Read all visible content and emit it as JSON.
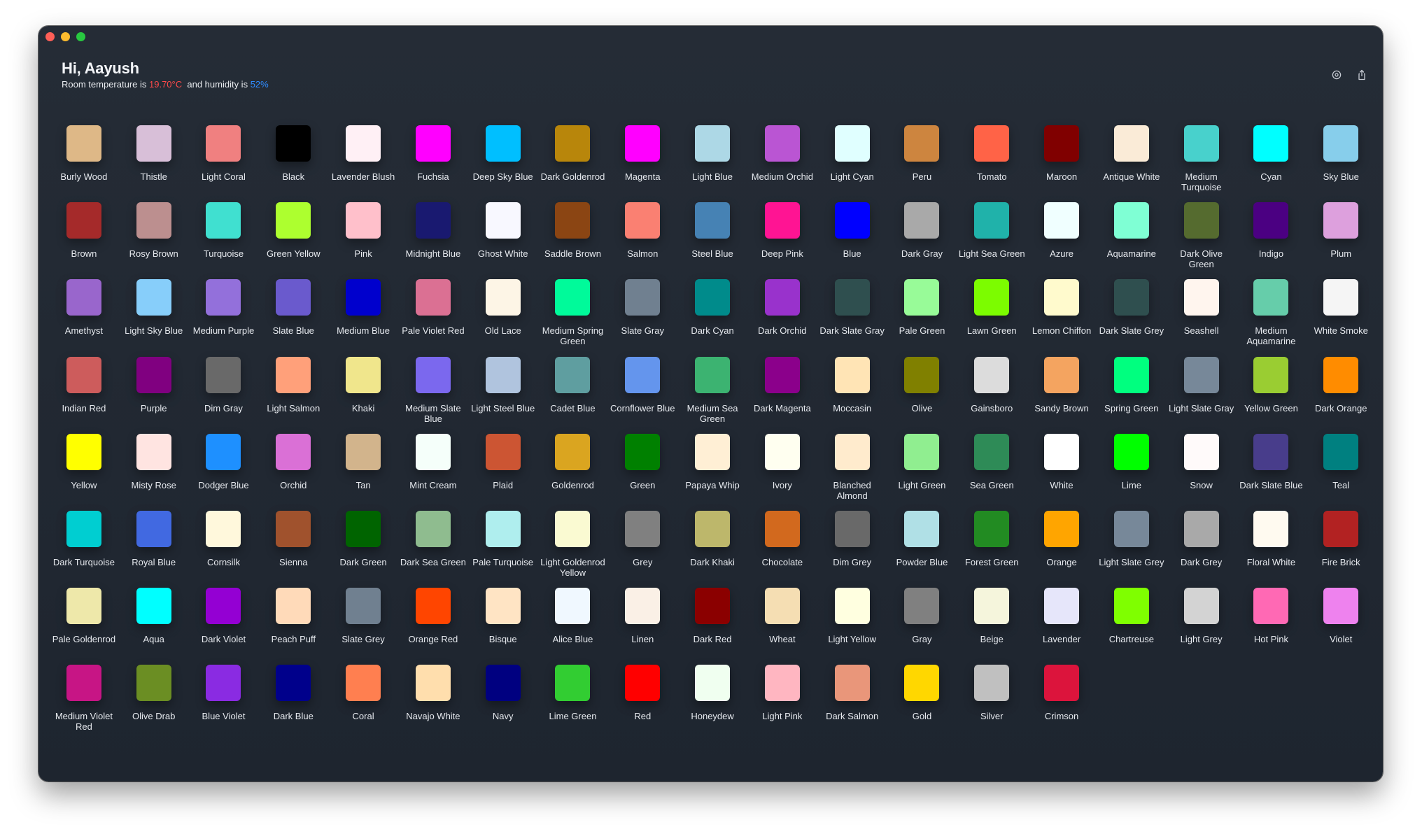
{
  "header": {
    "greeting": "Hi, Aayush",
    "temp_prefix": "Room temperature is ",
    "temperature": "19.70°C",
    "hum_prefix": "and humidity is ",
    "humidity": "52%"
  },
  "toolbar": {
    "icons": [
      "settings-icon",
      "share-icon"
    ]
  },
  "colors": [
    {
      "name": "Burly Wood",
      "hex": "#DEB887"
    },
    {
      "name": "Thistle",
      "hex": "#D8BFD8"
    },
    {
      "name": "Light Coral",
      "hex": "#F08080"
    },
    {
      "name": "Black",
      "hex": "#000000"
    },
    {
      "name": "Lavender Blush",
      "hex": "#FFF0F5"
    },
    {
      "name": "Fuchsia",
      "hex": "#FF00FF"
    },
    {
      "name": "Deep Sky Blue",
      "hex": "#00BFFF"
    },
    {
      "name": "Dark Goldenrod",
      "hex": "#B8860B"
    },
    {
      "name": "Magenta",
      "hex": "#FF00FF"
    },
    {
      "name": "Light Blue",
      "hex": "#ADD8E6"
    },
    {
      "name": "Medium Orchid",
      "hex": "#BA55D3"
    },
    {
      "name": "Light Cyan",
      "hex": "#E0FFFF"
    },
    {
      "name": "Peru",
      "hex": "#CD853F"
    },
    {
      "name": "Tomato",
      "hex": "#FF6347"
    },
    {
      "name": "Maroon",
      "hex": "#800000"
    },
    {
      "name": "Antique White",
      "hex": "#FAEBD7"
    },
    {
      "name": "Medium Turquoise",
      "hex": "#48D1CC"
    },
    {
      "name": "Cyan",
      "hex": "#00FFFF"
    },
    {
      "name": "Sky Blue",
      "hex": "#87CEEB"
    },
    {
      "name": "Brown",
      "hex": "#A52A2A"
    },
    {
      "name": "Rosy Brown",
      "hex": "#BC8F8F"
    },
    {
      "name": "Turquoise",
      "hex": "#40E0D0"
    },
    {
      "name": "Green Yellow",
      "hex": "#ADFF2F"
    },
    {
      "name": "Pink",
      "hex": "#FFC0CB"
    },
    {
      "name": "Midnight Blue",
      "hex": "#191970"
    },
    {
      "name": "Ghost White",
      "hex": "#F8F8FF"
    },
    {
      "name": "Saddle Brown",
      "hex": "#8B4513"
    },
    {
      "name": "Salmon",
      "hex": "#FA8072"
    },
    {
      "name": "Steel Blue",
      "hex": "#4682B4"
    },
    {
      "name": "Deep Pink",
      "hex": "#FF1493"
    },
    {
      "name": "Blue",
      "hex": "#0000FF"
    },
    {
      "name": "Dark Gray",
      "hex": "#A9A9A9"
    },
    {
      "name": "Light Sea Green",
      "hex": "#20B2AA"
    },
    {
      "name": "Azure",
      "hex": "#F0FFFF"
    },
    {
      "name": "Aquamarine",
      "hex": "#7FFFD4"
    },
    {
      "name": "Dark Olive Green",
      "hex": "#556B2F"
    },
    {
      "name": "Indigo",
      "hex": "#4B0082"
    },
    {
      "name": "Plum",
      "hex": "#DDA0DD"
    },
    {
      "name": "Amethyst",
      "hex": "#9966CC"
    },
    {
      "name": "Light Sky Blue",
      "hex": "#87CEFA"
    },
    {
      "name": "Medium Purple",
      "hex": "#9370DB"
    },
    {
      "name": "Slate Blue",
      "hex": "#6A5ACD"
    },
    {
      "name": "Medium Blue",
      "hex": "#0000CD"
    },
    {
      "name": "Pale Violet Red",
      "hex": "#DB7093"
    },
    {
      "name": "Old Lace",
      "hex": "#FDF5E6"
    },
    {
      "name": "Medium Spring Green",
      "hex": "#00FA9A"
    },
    {
      "name": "Slate Gray",
      "hex": "#708090"
    },
    {
      "name": "Dark Cyan",
      "hex": "#008B8B"
    },
    {
      "name": "Dark Orchid",
      "hex": "#9932CC"
    },
    {
      "name": "Dark Slate Gray",
      "hex": "#2F4F4F"
    },
    {
      "name": "Pale Green",
      "hex": "#98FB98"
    },
    {
      "name": "Lawn Green",
      "hex": "#7CFC00"
    },
    {
      "name": "Lemon Chiffon",
      "hex": "#FFFACD"
    },
    {
      "name": "Dark Slate Grey",
      "hex": "#2F4F4F"
    },
    {
      "name": "Seashell",
      "hex": "#FFF5EE"
    },
    {
      "name": "Medium Aquamarine",
      "hex": "#66CDAA"
    },
    {
      "name": "White Smoke",
      "hex": "#F5F5F5"
    },
    {
      "name": "Indian Red",
      "hex": "#CD5C5C"
    },
    {
      "name": "Purple",
      "hex": "#800080"
    },
    {
      "name": "Dim Gray",
      "hex": "#696969"
    },
    {
      "name": "Light Salmon",
      "hex": "#FFA07A"
    },
    {
      "name": "Khaki",
      "hex": "#F0E68C"
    },
    {
      "name": "Medium Slate Blue",
      "hex": "#7B68EE"
    },
    {
      "name": "Light Steel Blue",
      "hex": "#B0C4DE"
    },
    {
      "name": "Cadet Blue",
      "hex": "#5F9EA0"
    },
    {
      "name": "Cornflower Blue",
      "hex": "#6495ED"
    },
    {
      "name": "Medium Sea Green",
      "hex": "#3CB371"
    },
    {
      "name": "Dark Magenta",
      "hex": "#8B008B"
    },
    {
      "name": "Moccasin",
      "hex": "#FFE4B5"
    },
    {
      "name": "Olive",
      "hex": "#808000"
    },
    {
      "name": "Gainsboro",
      "hex": "#DCDCDC"
    },
    {
      "name": "Sandy Brown",
      "hex": "#F4A460"
    },
    {
      "name": "Spring Green",
      "hex": "#00FF7F"
    },
    {
      "name": "Light Slate Gray",
      "hex": "#778899"
    },
    {
      "name": "Yellow Green",
      "hex": "#9ACD32"
    },
    {
      "name": "Dark Orange",
      "hex": "#FF8C00"
    },
    {
      "name": "Yellow",
      "hex": "#FFFF00"
    },
    {
      "name": "Misty Rose",
      "hex": "#FFE4E1"
    },
    {
      "name": "Dodger Blue",
      "hex": "#1E90FF"
    },
    {
      "name": "Orchid",
      "hex": "#DA70D6"
    },
    {
      "name": "Tan",
      "hex": "#D2B48C"
    },
    {
      "name": "Mint Cream",
      "hex": "#F5FFFA"
    },
    {
      "name": "Plaid",
      "hex": "#CC5533"
    },
    {
      "name": "Goldenrod",
      "hex": "#DAA520"
    },
    {
      "name": "Green",
      "hex": "#008000"
    },
    {
      "name": "Papaya Whip",
      "hex": "#FFEFD5"
    },
    {
      "name": "Ivory",
      "hex": "#FFFFF0"
    },
    {
      "name": "Blanched Almond",
      "hex": "#FFEBCD"
    },
    {
      "name": "Light Green",
      "hex": "#90EE90"
    },
    {
      "name": "Sea Green",
      "hex": "#2E8B57"
    },
    {
      "name": "White",
      "hex": "#FFFFFF"
    },
    {
      "name": "Lime",
      "hex": "#00FF00"
    },
    {
      "name": "Snow",
      "hex": "#FFFAFA"
    },
    {
      "name": "Dark Slate Blue",
      "hex": "#483D8B"
    },
    {
      "name": "Teal",
      "hex": "#008080"
    },
    {
      "name": "Dark Turquoise",
      "hex": "#00CED1"
    },
    {
      "name": "Royal Blue",
      "hex": "#4169E1"
    },
    {
      "name": "Cornsilk",
      "hex": "#FFF8DC"
    },
    {
      "name": "Sienna",
      "hex": "#A0522D"
    },
    {
      "name": "Dark Green",
      "hex": "#006400"
    },
    {
      "name": "Dark Sea Green",
      "hex": "#8FBC8F"
    },
    {
      "name": "Pale Turquoise",
      "hex": "#AFEEEE"
    },
    {
      "name": "Light Goldenrod Yellow",
      "hex": "#FAFAD2"
    },
    {
      "name": "Grey",
      "hex": "#808080"
    },
    {
      "name": "Dark Khaki",
      "hex": "#BDB76B"
    },
    {
      "name": "Chocolate",
      "hex": "#D2691E"
    },
    {
      "name": "Dim Grey",
      "hex": "#696969"
    },
    {
      "name": "Powder Blue",
      "hex": "#B0E0E6"
    },
    {
      "name": "Forest Green",
      "hex": "#228B22"
    },
    {
      "name": "Orange",
      "hex": "#FFA500"
    },
    {
      "name": "Light Slate Grey",
      "hex": "#778899"
    },
    {
      "name": "Dark Grey",
      "hex": "#A9A9A9"
    },
    {
      "name": "Floral White",
      "hex": "#FFFAF0"
    },
    {
      "name": "Fire Brick",
      "hex": "#B22222"
    },
    {
      "name": "Pale Goldenrod",
      "hex": "#EEE8AA"
    },
    {
      "name": "Aqua",
      "hex": "#00FFFF"
    },
    {
      "name": "Dark Violet",
      "hex": "#9400D3"
    },
    {
      "name": "Peach Puff",
      "hex": "#FFDAB9"
    },
    {
      "name": "Slate Grey",
      "hex": "#708090"
    },
    {
      "name": "Orange Red",
      "hex": "#FF4500"
    },
    {
      "name": "Bisque",
      "hex": "#FFE4C4"
    },
    {
      "name": "Alice Blue",
      "hex": "#F0F8FF"
    },
    {
      "name": "Linen",
      "hex": "#FAF0E6"
    },
    {
      "name": "Dark Red",
      "hex": "#8B0000"
    },
    {
      "name": "Wheat",
      "hex": "#F5DEB3"
    },
    {
      "name": "Light Yellow",
      "hex": "#FFFFE0"
    },
    {
      "name": "Gray",
      "hex": "#808080"
    },
    {
      "name": "Beige",
      "hex": "#F5F5DC"
    },
    {
      "name": "Lavender",
      "hex": "#E6E6FA"
    },
    {
      "name": "Chartreuse",
      "hex": "#7FFF00"
    },
    {
      "name": "Light Grey",
      "hex": "#D3D3D3"
    },
    {
      "name": "Hot Pink",
      "hex": "#FF69B4"
    },
    {
      "name": "Violet",
      "hex": "#EE82EE"
    },
    {
      "name": "Medium Violet Red",
      "hex": "#C71585"
    },
    {
      "name": "Olive Drab",
      "hex": "#6B8E23"
    },
    {
      "name": "Blue Violet",
      "hex": "#8A2BE2"
    },
    {
      "name": "Dark Blue",
      "hex": "#00008B"
    },
    {
      "name": "Coral",
      "hex": "#FF7F50"
    },
    {
      "name": "Navajo White",
      "hex": "#FFDEAD"
    },
    {
      "name": "Navy",
      "hex": "#000080"
    },
    {
      "name": "Lime Green",
      "hex": "#32CD32"
    },
    {
      "name": "Red",
      "hex": "#FF0000"
    },
    {
      "name": "Honeydew",
      "hex": "#F0FFF0"
    },
    {
      "name": "Light Pink",
      "hex": "#FFB6C1"
    },
    {
      "name": "Dark Salmon",
      "hex": "#E9967A"
    },
    {
      "name": "Gold",
      "hex": "#FFD700"
    },
    {
      "name": "Silver",
      "hex": "#C0C0C0"
    },
    {
      "name": "Crimson",
      "hex": "#DC143C"
    }
  ]
}
